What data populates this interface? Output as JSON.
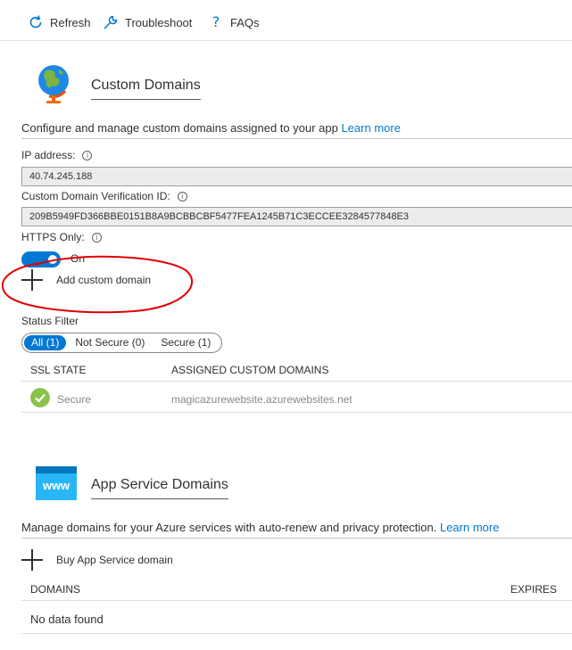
{
  "toolbar": {
    "refresh_label": "Refresh",
    "troubleshoot_label": "Troubleshoot",
    "faqs_label": "FAQs",
    "refresh_icon": "refresh-icon",
    "troubleshoot_icon": "wrench-icon",
    "faqs_icon": "question-icon"
  },
  "custom_domains": {
    "title": "Custom Domains",
    "icon": "globe-icon",
    "description": "Configure and manage custom domains assigned to your app",
    "learn_more": "Learn more",
    "ip_label": "IP address:",
    "ip_value": "40.74.245.188",
    "verification_label": "Custom Domain Verification ID:",
    "verification_value": "209B5949FD366BBE0151B8A9BCBBCBF5477FEA1245B71C3ECCEE3284577848E3",
    "https_label": "HTTPS Only:",
    "https_state": "On",
    "https_on": true,
    "add_label": "Add custom domain",
    "status_filter_label": "Status Filter",
    "filters": [
      "All (1)",
      "Not Secure (0)",
      "Secure (1)"
    ],
    "active_filter": 0,
    "columns": [
      "SSL STATE",
      "ASSIGNED CUSTOM DOMAINS"
    ],
    "rows": [
      {
        "ssl_state": "Secure",
        "domain": "magicazurewebsite.azurewebsites.net"
      }
    ]
  },
  "app_service_domains": {
    "title": "App Service Domains",
    "icon": "www-icon",
    "icon_text": "www",
    "description": "Manage domains for your Azure services with auto-renew and privacy protection.",
    "learn_more": "Learn more",
    "buy_label": "Buy App Service domain",
    "columns": [
      "DOMAINS",
      "EXPIRES"
    ],
    "empty_text": "No data found"
  },
  "colors": {
    "accent": "#0078d4",
    "secure_check": "#8bc34a",
    "annotation": "#e00000"
  }
}
